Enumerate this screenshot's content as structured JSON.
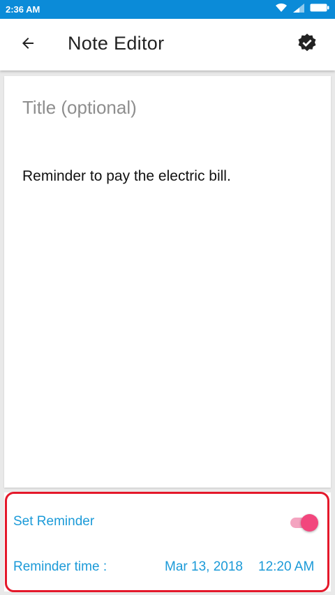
{
  "status_bar": {
    "time": "2:36 AM",
    "icons": [
      "wifi-icon",
      "signal-icon",
      "battery-icon"
    ]
  },
  "app_bar": {
    "title": "Note Editor",
    "back_icon": "arrow-back-icon",
    "save_icon": "verified-badge-icon"
  },
  "editor": {
    "title_placeholder": "Title (optional)",
    "body": "Reminder to pay the electric bill."
  },
  "reminder": {
    "set_label": "Set Reminder",
    "enabled": true,
    "time_label": "Reminder time :",
    "date": "Mar 13, 2018",
    "time": "12:20 AM"
  },
  "colors": {
    "status_bar": "#0b8bd8",
    "accent_text": "#1b9ad8",
    "toggle_thumb": "#f2467d",
    "toggle_track": "#f4a4c0",
    "highlight_border": "#e4182a"
  }
}
